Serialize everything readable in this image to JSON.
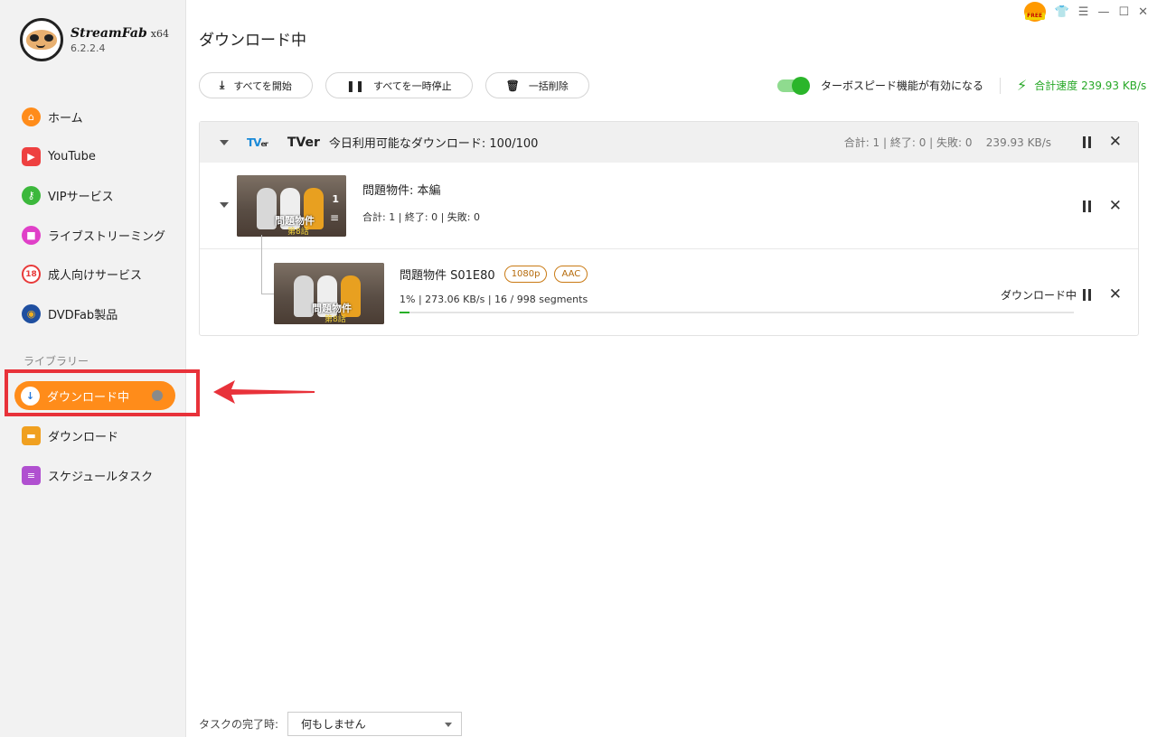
{
  "app": {
    "brand": "StreamFab",
    "arch": "x64",
    "version": "6.2.2.4"
  },
  "sidebar": {
    "items": [
      {
        "label": "ホーム",
        "icon": "home-icon",
        "color": "#ff8c1a"
      },
      {
        "label": "YouTube",
        "icon": "youtube-icon",
        "color": "#ee4040"
      },
      {
        "label": "VIPサービス",
        "icon": "key-icon",
        "color": "#3cb83c"
      },
      {
        "label": "ライブストリーミング",
        "icon": "live-camera-icon",
        "color": "#e040c8"
      },
      {
        "label": "成人向けサービス",
        "icon": "adult-forbidden-icon",
        "color": "#e83a3a"
      },
      {
        "label": "DVDFab製品",
        "icon": "dvdfab-icon",
        "color": "#1f4fa0"
      }
    ],
    "library_label": "ライブラリー",
    "library": [
      {
        "label": "ダウンロード中",
        "icon": "download-arrow-icon",
        "active": true
      },
      {
        "label": "ダウンロード",
        "icon": "folder-icon",
        "color": "#f0a020"
      },
      {
        "label": "スケジュールタスク",
        "icon": "schedule-list-icon",
        "color": "#b050d0"
      }
    ]
  },
  "header": {
    "title": "ダウンロード中",
    "free_badge": "FREE"
  },
  "toolbar": {
    "start_all": "すべてを開始",
    "pause_all": "すべてを一時停止",
    "delete_all": "一括削除",
    "turbo_label": "ターボスピード機能が有効になる",
    "turbo_enabled": true,
    "total_speed": "合計速度 239.93 KB/s"
  },
  "group": {
    "service": "TVer",
    "logo_text": "TV",
    "logo_sub": "er",
    "available": "今日利用可能なダウンロード: 100/100",
    "stats": "合計: 1 | 終了: 0 | 失敗: 0",
    "speed": "239.93 KB/s",
    "task": {
      "title": "問題物件: 本編",
      "stats": "合計: 1 |  終了: 0 |  失敗: 0",
      "thumb_count": "1",
      "thumb_title": "問題物件",
      "thumb_episode": "第8話",
      "episode": {
        "title": "問題物件 S01E80",
        "badges": [
          "1080p",
          "AAC"
        ],
        "stats": "1% |  273.06 KB/s |  16 / 998 segments",
        "progress": 0.01,
        "status": "ダウンロード中"
      }
    }
  },
  "footer": {
    "label": "タスクの完了時:",
    "selected": "何もしません"
  }
}
